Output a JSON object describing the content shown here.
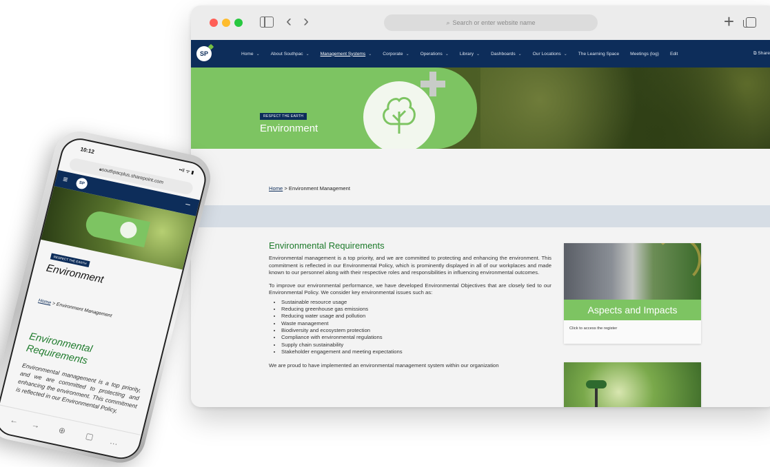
{
  "browser": {
    "url_placeholder": "Search or enter website name",
    "back_glyph": "‹",
    "forward_glyph": "›",
    "new_tab_glyph": "+"
  },
  "nav": {
    "logo": "SP",
    "items": [
      {
        "label": "Home"
      },
      {
        "label": "About Southpac"
      },
      {
        "label": "Management Systems",
        "active": true
      },
      {
        "label": "Corporate"
      },
      {
        "label": "Operations"
      },
      {
        "label": "Library"
      },
      {
        "label": "Dashboards"
      },
      {
        "label": "Our Locations"
      },
      {
        "label": "The Learning Space"
      },
      {
        "label": "Meetings (log)"
      },
      {
        "label": "Edit"
      }
    ],
    "share": "Share"
  },
  "hero": {
    "badge": "RESPECT THE EARTH",
    "title": "Environment"
  },
  "breadcrumb": {
    "home": "Home",
    "separator": " > ",
    "current": "Environment Management"
  },
  "content": {
    "heading": "Environmental Requirements",
    "para1": "Environmental management is a top priority, and we are committed to protecting and enhancing the environment. This commitment is reflected in our Environmental Policy, which is prominently displayed in all of our workplaces and made known to our personnel along with their respective roles and responsibilities in influencing environmental outcomes.",
    "para2": "To improve our environmental performance, we have developed Environmental Objectives that are closely tied to our Environmental Policy. We consider key environmental issues such as:",
    "issues": [
      "Sustainable resource usage",
      "Reducing greenhouse gas emissions",
      "Reducing water usage and pollution",
      "Waste management",
      "Biodiversity and ecosystem protection",
      "Compliance with environmental regulations",
      "Supply chain sustainability",
      "Stakeholder engagement and meeting expectations"
    ],
    "para3": "We are proud to have implemented an environmental management system within our organization"
  },
  "cards": {
    "aspects_title": "Aspects and Impacts",
    "aspects_caption": "Click to access the register"
  },
  "phone": {
    "time": "10:12",
    "status_icons": "••ll ᯤ ▮",
    "url": "southpacplus.sharepoint.com",
    "logo": "SP",
    "badge": "RESPECT THE EARTH",
    "title": "Environment",
    "bc_home": "Home",
    "bc_rest": " > Environment Management",
    "heading": "Environmental Requirements",
    "text": "Environmental management is a top priority, and we are committed to protecting and enhancing the environment. This commitment is reflected in our Environmental Policy,"
  },
  "colors": {
    "navy": "#0d2d5a",
    "green": "#7dc462",
    "heading_green": "#1d7a2b"
  }
}
